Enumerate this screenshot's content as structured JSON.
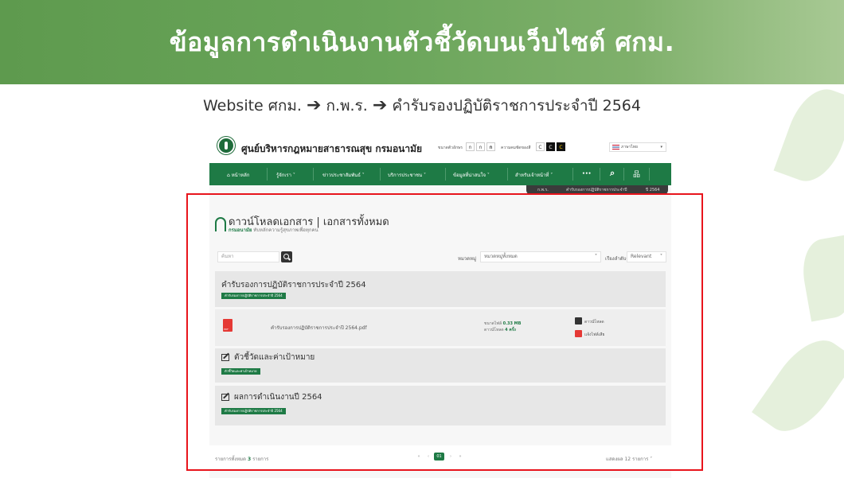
{
  "slide": {
    "title": "ข้อมูลการดำเนินงานตัวชี้วัดบนเว็บไซต์ ศกม.",
    "path": [
      "Website ศกม.",
      "ก.พ.ร.",
      "คำรับรองปฏิบัติราชการประจำปี 2564"
    ],
    "arrow": "➔"
  },
  "site": {
    "name": "ศูนย์บริหารกฎหมายสาธารณสุข กรมอนามัย",
    "toolbar": {
      "font_label": "ขนาดตัวอักษร",
      "font_buttons": [
        "ก",
        "ก",
        "ก"
      ],
      "contrast_label": "ความคมชัดของสี",
      "contrast_buttons": [
        "C",
        "C",
        "C"
      ],
      "language": "ภาษาไทย"
    },
    "nav": [
      "หน้าหลัก",
      "รู้จักเรา",
      "ข่าวประชาสัมพันธ์",
      "บริการประชาชน",
      "ข้อมูลที่น่าสนใจ",
      "สำหรับเจ้าหน้าที่",
      "•••"
    ],
    "breadcrumb": [
      "ก.พ.ร.",
      "คำรับรองการปฏิบัติราชการประจำปี",
      "ปี 2564"
    ],
    "page_title": "ดาวน์โหลดเอกสาร | เอกสารทั้งหมด",
    "page_sub_brand": "กรมอนามัย",
    "page_sub": "ทับหลักความรู้สุขภาพเพื่อทุกคน",
    "search_placeholder": "ค้นหา",
    "category_label": "หมวดหมู่",
    "category_value": "หมวดหมู่ทั้งหมด",
    "sort_label": "เรียงลำดับข้อมูล",
    "sort_value": "Relevant",
    "sections": [
      {
        "title": "คำรับรองการปฏิบัติราชการประจำปี 2564",
        "tag": "คำรับรองการปฏิบัติราชการประจำปี 2564",
        "file": {
          "name": "คำรับรองการปฏิบัติราชการประจำปี 2564.pdf",
          "size_label": "ขนาดไฟล์",
          "size": "0.33 MB",
          "downloads_label": "ดาวน์โหลด",
          "downloads": "4 ครั้ง",
          "download_action": "ดาวน์โหลด",
          "report_action": "แจ้งไฟล์เสีย"
        }
      },
      {
        "title": "ตัวชี้วัดและค่าเป้าหมาย",
        "tag": "ตัวชี้วัดและค่าเป้าหมาย"
      },
      {
        "title": "ผลการดำเนินงานปี 2564",
        "tag": "คำรับรองการปฏิบัติราชการประจำปี 2564"
      }
    ],
    "pager": {
      "total_label": "รายการทั้งหมด",
      "total": "3",
      "total_unit": "รายการ",
      "pages": [
        "«",
        "‹",
        "01",
        "›",
        "»"
      ],
      "show_label": "แสดงผล",
      "per_page": "12 รายการ"
    }
  },
  "colors": {
    "brand_green": "#1e7a45",
    "frame_red": "#e8141c",
    "header_green": "#6aa55a"
  },
  "icons": [
    "home-icon",
    "search-icon",
    "sitemap-icon",
    "pdf-icon",
    "download-icon",
    "report-icon",
    "edit-icon",
    "chevron-down-icon"
  ]
}
